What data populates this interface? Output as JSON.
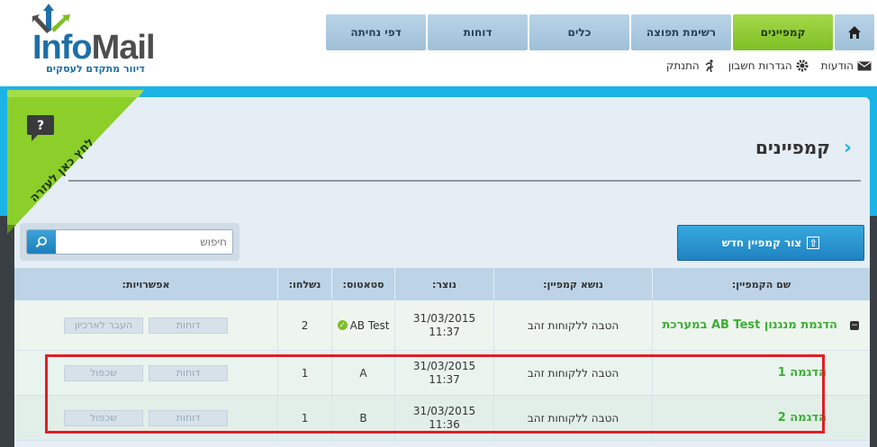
{
  "logo": {
    "info": "Info",
    "mail": "Mail",
    "tagline": "דיוור מתקדם לעסקים"
  },
  "nav": {
    "home_icon": "home-icon",
    "items": [
      {
        "label": "קמפיינים",
        "active": true
      },
      {
        "label": "רשימת תפוצה",
        "active": false
      },
      {
        "label": "כלים",
        "active": false
      },
      {
        "label": "דוחות",
        "active": false
      },
      {
        "label": "דפי נחיתה",
        "active": false
      }
    ]
  },
  "subnav": {
    "messages": "הודעות",
    "settings": "הגדרות חשבון",
    "logout": "התנתק"
  },
  "help": {
    "text": "לחץ כאן לעזרה",
    "icon": "?"
  },
  "page": {
    "title": "קמפיינים",
    "chevron": "›"
  },
  "toolbar": {
    "create_label": "צור קמפיין חדש",
    "search_placeholder": "חיפוש"
  },
  "table": {
    "headers": {
      "name": "שם הקמפיין:",
      "subject": "נושא קמפיין:",
      "created": "נוצר:",
      "status": "סטאטוס:",
      "sent": "נשלחו:",
      "options": "אפשרויות:"
    },
    "rows": [
      {
        "name": "הדגמת מנגנון AB Test במערכת",
        "subject": "הטבה ללקוחות זהב",
        "date": "31/03/2015",
        "time": "11:37",
        "status": "AB Test",
        "sent": "2",
        "btn1": "דוחות",
        "btn2": "העבר לארכיון",
        "toggle": "−"
      },
      {
        "name": "הדגמה 1",
        "subject": "הטבה ללקוחות זהב",
        "date": "31/03/2015",
        "time": "11:37",
        "status": "A",
        "sent": "1",
        "btn1": "דוחות",
        "btn2": "שכפול"
      },
      {
        "name": "הדגמה 2",
        "subject": "הטבה ללקוחות זהב",
        "date": "31/03/2015",
        "time": "11:36",
        "status": "B",
        "sent": "1",
        "btn1": "דוחות",
        "btn2": "שכפול"
      }
    ]
  },
  "colors": {
    "accent_cyan": "#1bb4e6",
    "nav_active": "#7fbf25",
    "campaign_name": "#3cae34",
    "highlight": "#e01e27"
  }
}
